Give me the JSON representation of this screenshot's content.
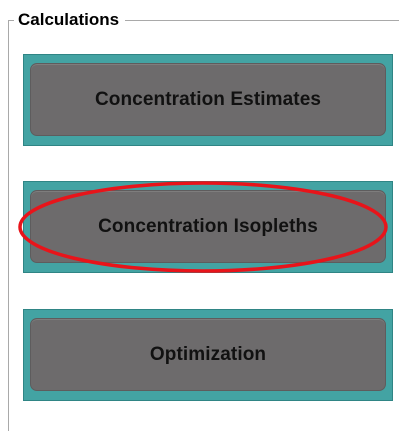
{
  "groupbox": {
    "title": "Calculations"
  },
  "buttons": [
    {
      "label": "Concentration Estimates"
    },
    {
      "label": "Concentration Isopleths"
    },
    {
      "label": "Optimization"
    }
  ],
  "colors": {
    "button_frame": "#43a3a3",
    "button_face": "#6d6b6c",
    "highlight": "#e8141a"
  }
}
